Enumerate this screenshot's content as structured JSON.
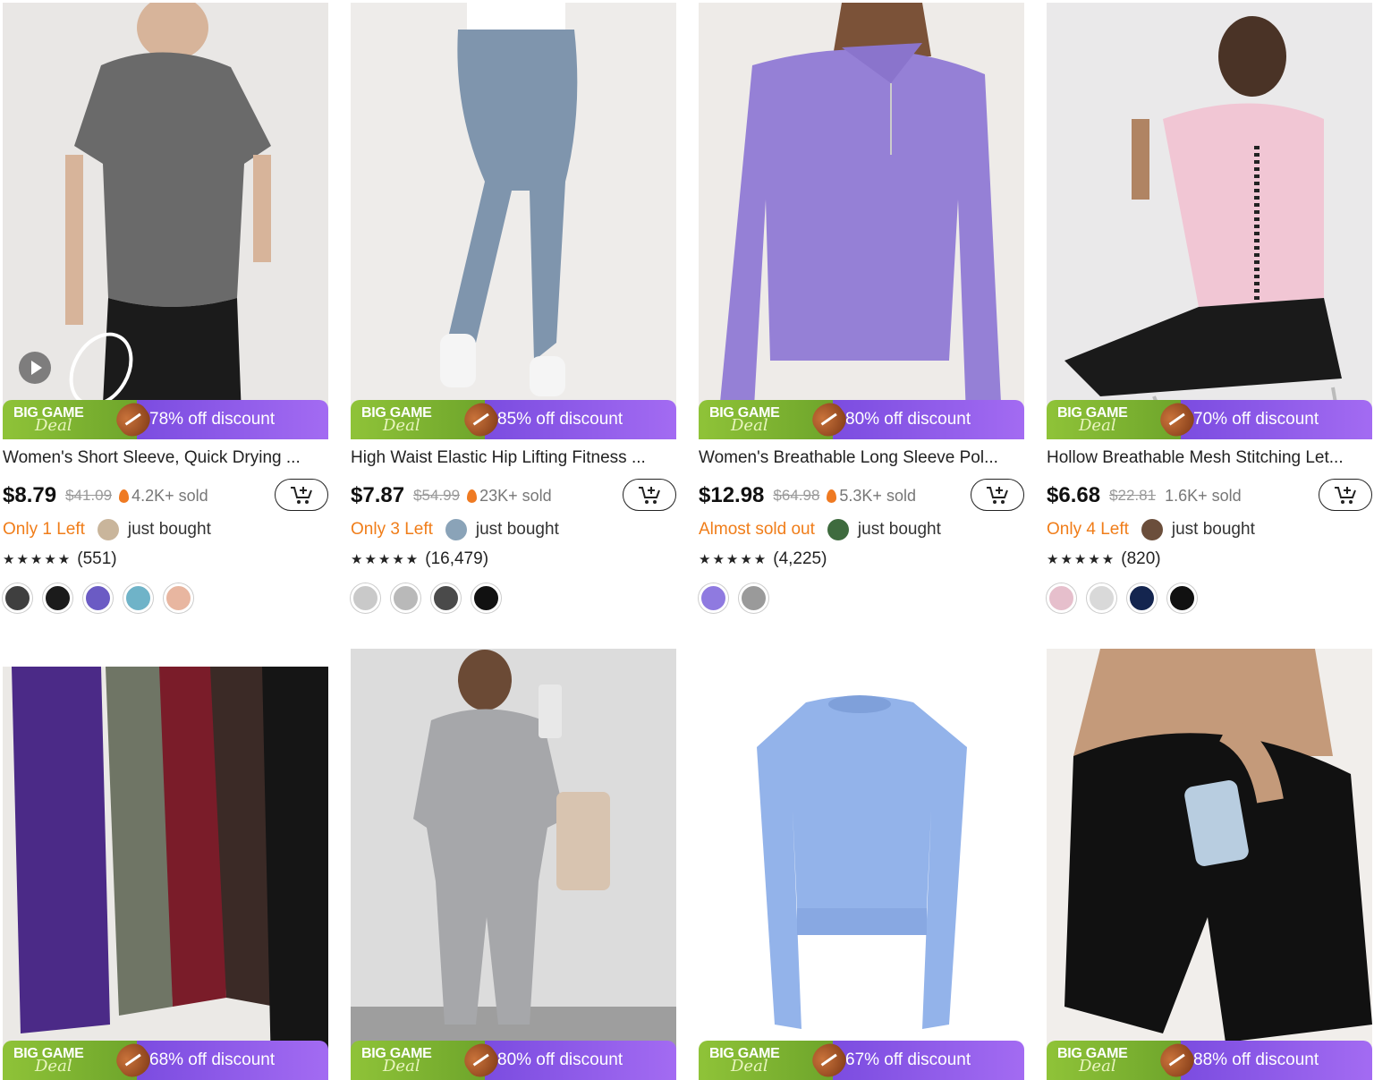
{
  "products": [
    {
      "title": "Women's Short Sleeve, Quick Drying ...",
      "discount": "78% off discount",
      "price": "$8.79",
      "original_price": "$41.09",
      "sold": "4.2K+ sold",
      "stock": "Only 1 Left",
      "just_bought": "just bought",
      "stars": "★★★★★",
      "rating_count": "(551)",
      "has_video": true,
      "swatches": [
        "#3f3f3f",
        "#1b1b1b",
        "#6b5bc4",
        "#6fb3c8",
        "#e8b6a0"
      ],
      "avatar_color": "#c9b59b",
      "image_bg": "#e9e7e5",
      "product_color": "#6a6a6a"
    },
    {
      "title": "High Waist Elastic Hip Lifting Fitness ...",
      "discount": "85% off discount",
      "price": "$7.87",
      "original_price": "$54.99",
      "sold": "23K+ sold",
      "stock": "Only 3 Left",
      "just_bought": "just bought",
      "stars": "★★★★★",
      "rating_count": "(16,479)",
      "swatches": [
        "#c9c9c9",
        "#b9b9b9",
        "#4a4a4a",
        "#111111"
      ],
      "avatar_color": "#8aa3b8",
      "image_bg": "#eeecea",
      "product_color": "#7f95ad"
    },
    {
      "title": "Women's Breathable Long Sleeve Pol...",
      "discount": "80% off discount",
      "price": "$12.98",
      "original_price": "$64.98",
      "sold": "5.3K+ sold",
      "stock": "Almost sold out",
      "just_bought": "just bought",
      "stars": "★★★★★",
      "rating_count": "(4,225)",
      "swatches": [
        "#8f7ae0",
        "#9a9a9a"
      ],
      "avatar_color": "#3e6b3e",
      "image_bg": "#eeebe8",
      "product_color": "#9580d6"
    },
    {
      "title": "Hollow Breathable Mesh Stitching Let...",
      "discount": "70% off discount",
      "price": "$6.68",
      "original_price": "$22.81",
      "sold": "1.6K+ sold",
      "stock": "Only 4 Left",
      "just_bought": "just bought",
      "stars": "★★★★★",
      "rating_count": "(820)",
      "swatches": [
        "#e6bfcc",
        "#d9d9d9",
        "#14254f",
        "#111111"
      ],
      "avatar_color": "#6b4e3b",
      "image_bg": "#eae9ea",
      "product_color": "#f1c6d4"
    },
    {
      "discount": "68% off discount",
      "image_bg": "#ebe9e6",
      "product_colors": [
        "#4b2a87",
        "#6f7565",
        "#7a1c29",
        "#3b2a26",
        "#151515"
      ]
    },
    {
      "discount": "80% off discount",
      "image_bg": "#dcdcdc",
      "product_color": "#a6a7aa"
    },
    {
      "discount": "67% off discount",
      "image_bg": "#ffffff",
      "product_color": "#93b3ea"
    },
    {
      "discount": "88% off discount",
      "image_bg": "#f1eeeb",
      "product_color": "#111111"
    }
  ],
  "promo": {
    "big_game": "BIG GAME",
    "deal": "Deal"
  }
}
